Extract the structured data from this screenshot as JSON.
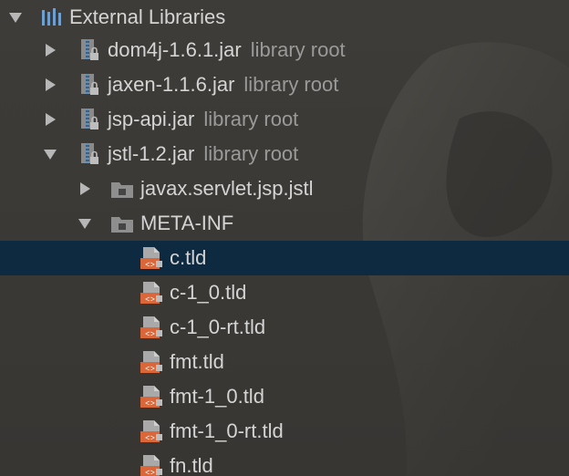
{
  "tree": {
    "root": {
      "label": "External Libraries",
      "expanded": true,
      "icon": "libraries-icon"
    },
    "libraries": [
      {
        "label": "dom4j-1.6.1.jar",
        "sublabel": "library root",
        "expanded": false,
        "icon": "jar-icon"
      },
      {
        "label": "jaxen-1.1.6.jar",
        "sublabel": "library root",
        "expanded": false,
        "icon": "jar-icon"
      },
      {
        "label": "jsp-api.jar",
        "sublabel": "library root",
        "expanded": false,
        "icon": "jar-icon"
      },
      {
        "label": "jstl-1.2.jar",
        "sublabel": "library root",
        "expanded": true,
        "icon": "jar-icon"
      }
    ],
    "jstl_children": [
      {
        "label": "javax.servlet.jsp.jstl",
        "expanded": false,
        "icon": "package-folder-icon"
      },
      {
        "label": "META-INF",
        "expanded": true,
        "icon": "package-folder-icon"
      }
    ],
    "meta_inf_files": [
      {
        "label": "c.tld",
        "selected": true,
        "icon": "tld-file-icon"
      },
      {
        "label": "c-1_0.tld",
        "selected": false,
        "icon": "tld-file-icon"
      },
      {
        "label": "c-1_0-rt.tld",
        "selected": false,
        "icon": "tld-file-icon"
      },
      {
        "label": "fmt.tld",
        "selected": false,
        "icon": "tld-file-icon"
      },
      {
        "label": "fmt-1_0.tld",
        "selected": false,
        "icon": "tld-file-icon"
      },
      {
        "label": "fmt-1_0-rt.tld",
        "selected": false,
        "icon": "tld-file-icon"
      },
      {
        "label": "fn.tld",
        "selected": false,
        "icon": "tld-file-icon"
      }
    ]
  },
  "colors": {
    "background": "#3b3936",
    "selection": "#0d2a40",
    "text": "#d4d4d4",
    "subtext": "#9a9a9a",
    "xml_icon": "#d9673a"
  }
}
